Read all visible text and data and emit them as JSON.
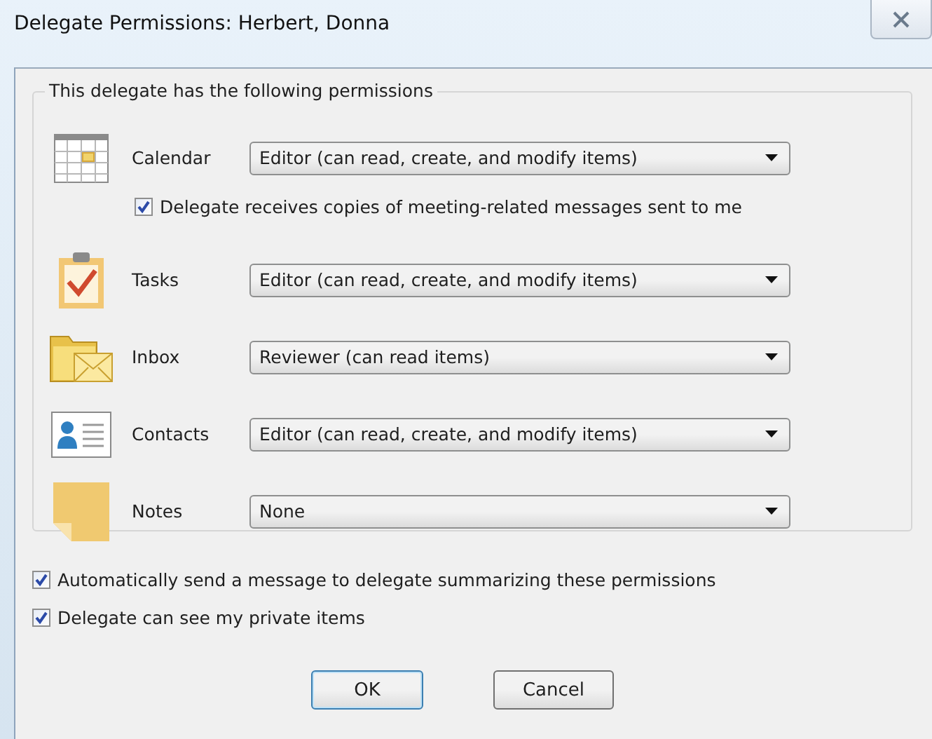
{
  "window": {
    "title": "Delegate Permissions: Herbert, Donna"
  },
  "group": {
    "legend": "This delegate has the following permissions"
  },
  "permissions": [
    {
      "kind": "calendar",
      "label": "Calendar",
      "value": "Editor (can read, create, and modify items)",
      "option": {
        "label": "Delegate receives copies of meeting-related messages sent to me",
        "checked": true
      }
    },
    {
      "kind": "tasks",
      "label": "Tasks",
      "value": "Editor (can read, create, and modify items)"
    },
    {
      "kind": "inbox",
      "label": "Inbox",
      "value": "Reviewer (can read items)"
    },
    {
      "kind": "contacts",
      "label": "Contacts",
      "value": "Editor (can read, create, and modify items)"
    },
    {
      "kind": "notes",
      "label": "Notes",
      "value": "None"
    }
  ],
  "options": [
    {
      "label": "Automatically send a message to delegate summarizing these permissions",
      "checked": true
    },
    {
      "label": "Delegate can see my private items",
      "checked": true
    }
  ],
  "buttons": [
    {
      "label": "OK",
      "kind": "default"
    },
    {
      "label": "Cancel",
      "kind": "normal"
    }
  ]
}
